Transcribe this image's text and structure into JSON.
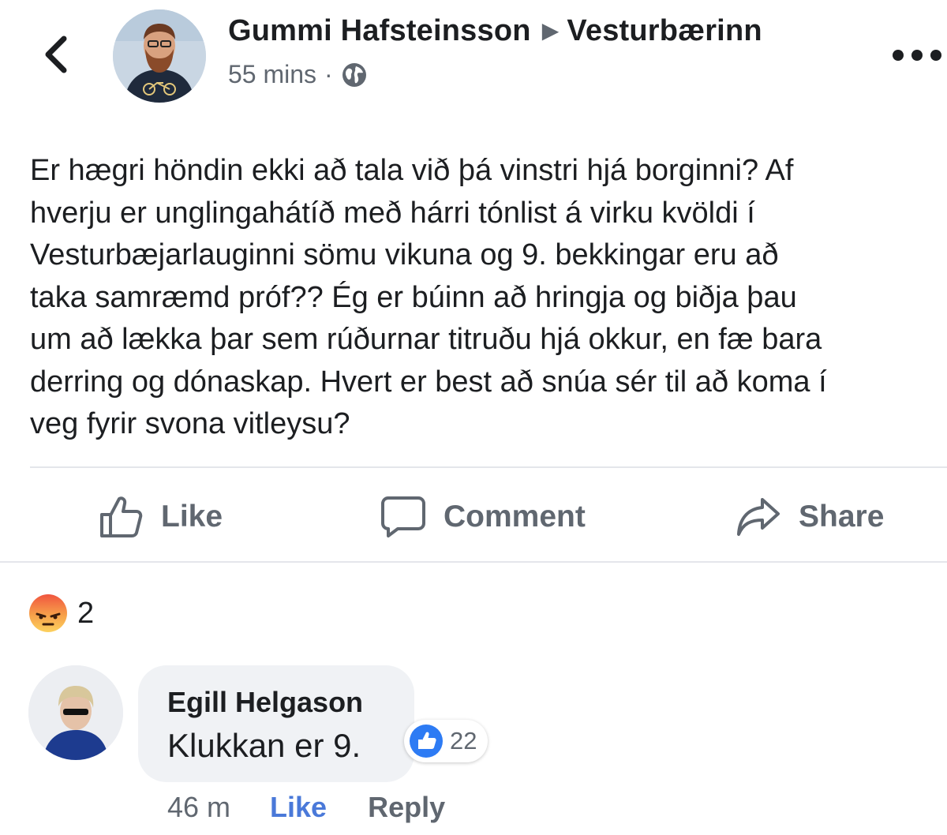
{
  "header": {
    "author": "Gummi Hafsteinsson",
    "target": "Vesturbærinn",
    "time": "55 mins",
    "separator": "·",
    "audience_icon": "globe-icon",
    "back_icon": "chevron-left-icon",
    "more_icon": "more-dots-icon"
  },
  "post": {
    "text": "Er hægri höndin ekki að tala við þá vinstri hjá borginni? Af\nhverju er unglingahátíð með hárri tónlist á virku kvöldi í\nVesturbæjarlauginni sömu vikuna og 9. bekkingar eru að\ntaka samræmd próf?? Ég er búinn að hringja og biðja þau\num að lækka þar sem rúðurnar titruðu hjá okkur, en fæ bara\nderring og dónaskap. Hvert er best að snúa sér til að koma í\nveg fyrir svona vitleysu?"
  },
  "actions": {
    "like": "Like",
    "comment": "Comment",
    "share": "Share"
  },
  "reactions": {
    "type": "angry",
    "count": "2"
  },
  "comment": {
    "author": "Egill Helgason",
    "text": "Klukkan er 9.",
    "reaction_count": "22",
    "time": "46 m",
    "like": "Like",
    "reply": "Reply"
  },
  "colors": {
    "text": "#1c1e21",
    "secondary": "#606770",
    "link_blue": "#4a79d9",
    "bubble": "#f0f2f5",
    "divider": "#e4e6eb"
  }
}
